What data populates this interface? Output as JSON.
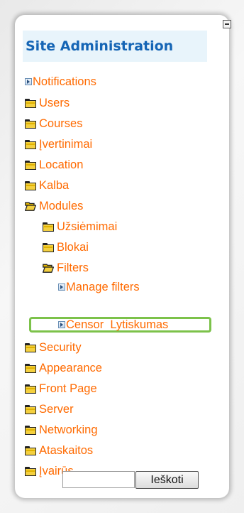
{
  "block": {
    "title": "Site Administration",
    "collapse_icon": "minus-box-icon"
  },
  "tree": {
    "notifications": "Notifications",
    "users": "Users",
    "courses": "Courses",
    "ivertinimai": "Įvertinimai",
    "location": "Location",
    "kalba": "Kalba",
    "modules": "Modules",
    "uzsiemimai": "Užsiėmimai",
    "blokai": "Blokai",
    "filters": "Filters",
    "manage_filters": "Manage filters",
    "censor": "Censor  Lytiskumas",
    "security": "Security",
    "appearance": "Appearance",
    "front_page": "Front Page",
    "server": "Server",
    "networking": "Networking",
    "ataskaitos": "Ataskaitos",
    "ivairus": "Įvairūs"
  },
  "search": {
    "value": "",
    "button_label": "Ieškoti"
  },
  "colors": {
    "link": "#ff6a00",
    "header_text": "#1565b5",
    "header_bg": "#e8f4fb",
    "highlight": "#7cc24a"
  }
}
